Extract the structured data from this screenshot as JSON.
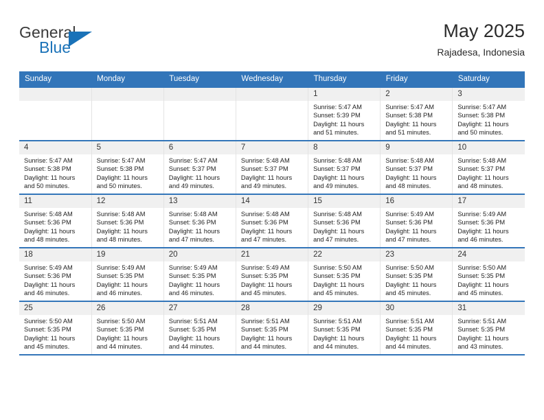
{
  "brand": {
    "name_top": "General",
    "name_bottom": "Blue",
    "triangle_color": "#1a72b8"
  },
  "header": {
    "month_title": "May 2025",
    "location": "Rajadesa, Indonesia"
  },
  "theme": {
    "header_bg": "#3275b9",
    "header_text": "#ffffff",
    "daynum_bg": "#f0f0f0",
    "row_border": "#3275b9"
  },
  "weekdays": [
    "Sunday",
    "Monday",
    "Tuesday",
    "Wednesday",
    "Thursday",
    "Friday",
    "Saturday"
  ],
  "labels": {
    "sunrise_prefix": "Sunrise:",
    "sunset_prefix": "Sunset:",
    "daylight_prefix": "Daylight:"
  },
  "weeks": [
    [
      {
        "day": "",
        "sunrise": "",
        "sunset": "",
        "daylight": ""
      },
      {
        "day": "",
        "sunrise": "",
        "sunset": "",
        "daylight": ""
      },
      {
        "day": "",
        "sunrise": "",
        "sunset": "",
        "daylight": ""
      },
      {
        "day": "",
        "sunrise": "",
        "sunset": "",
        "daylight": ""
      },
      {
        "day": "1",
        "sunrise": "Sunrise: 5:47 AM",
        "sunset": "Sunset: 5:39 PM",
        "daylight": "Daylight: 11 hours and 51 minutes."
      },
      {
        "day": "2",
        "sunrise": "Sunrise: 5:47 AM",
        "sunset": "Sunset: 5:38 PM",
        "daylight": "Daylight: 11 hours and 51 minutes."
      },
      {
        "day": "3",
        "sunrise": "Sunrise: 5:47 AM",
        "sunset": "Sunset: 5:38 PM",
        "daylight": "Daylight: 11 hours and 50 minutes."
      }
    ],
    [
      {
        "day": "4",
        "sunrise": "Sunrise: 5:47 AM",
        "sunset": "Sunset: 5:38 PM",
        "daylight": "Daylight: 11 hours and 50 minutes."
      },
      {
        "day": "5",
        "sunrise": "Sunrise: 5:47 AM",
        "sunset": "Sunset: 5:38 PM",
        "daylight": "Daylight: 11 hours and 50 minutes."
      },
      {
        "day": "6",
        "sunrise": "Sunrise: 5:47 AM",
        "sunset": "Sunset: 5:37 PM",
        "daylight": "Daylight: 11 hours and 49 minutes."
      },
      {
        "day": "7",
        "sunrise": "Sunrise: 5:48 AM",
        "sunset": "Sunset: 5:37 PM",
        "daylight": "Daylight: 11 hours and 49 minutes."
      },
      {
        "day": "8",
        "sunrise": "Sunrise: 5:48 AM",
        "sunset": "Sunset: 5:37 PM",
        "daylight": "Daylight: 11 hours and 49 minutes."
      },
      {
        "day": "9",
        "sunrise": "Sunrise: 5:48 AM",
        "sunset": "Sunset: 5:37 PM",
        "daylight": "Daylight: 11 hours and 48 minutes."
      },
      {
        "day": "10",
        "sunrise": "Sunrise: 5:48 AM",
        "sunset": "Sunset: 5:37 PM",
        "daylight": "Daylight: 11 hours and 48 minutes."
      }
    ],
    [
      {
        "day": "11",
        "sunrise": "Sunrise: 5:48 AM",
        "sunset": "Sunset: 5:36 PM",
        "daylight": "Daylight: 11 hours and 48 minutes."
      },
      {
        "day": "12",
        "sunrise": "Sunrise: 5:48 AM",
        "sunset": "Sunset: 5:36 PM",
        "daylight": "Daylight: 11 hours and 48 minutes."
      },
      {
        "day": "13",
        "sunrise": "Sunrise: 5:48 AM",
        "sunset": "Sunset: 5:36 PM",
        "daylight": "Daylight: 11 hours and 47 minutes."
      },
      {
        "day": "14",
        "sunrise": "Sunrise: 5:48 AM",
        "sunset": "Sunset: 5:36 PM",
        "daylight": "Daylight: 11 hours and 47 minutes."
      },
      {
        "day": "15",
        "sunrise": "Sunrise: 5:48 AM",
        "sunset": "Sunset: 5:36 PM",
        "daylight": "Daylight: 11 hours and 47 minutes."
      },
      {
        "day": "16",
        "sunrise": "Sunrise: 5:49 AM",
        "sunset": "Sunset: 5:36 PM",
        "daylight": "Daylight: 11 hours and 47 minutes."
      },
      {
        "day": "17",
        "sunrise": "Sunrise: 5:49 AM",
        "sunset": "Sunset: 5:36 PM",
        "daylight": "Daylight: 11 hours and 46 minutes."
      }
    ],
    [
      {
        "day": "18",
        "sunrise": "Sunrise: 5:49 AM",
        "sunset": "Sunset: 5:36 PM",
        "daylight": "Daylight: 11 hours and 46 minutes."
      },
      {
        "day": "19",
        "sunrise": "Sunrise: 5:49 AM",
        "sunset": "Sunset: 5:35 PM",
        "daylight": "Daylight: 11 hours and 46 minutes."
      },
      {
        "day": "20",
        "sunrise": "Sunrise: 5:49 AM",
        "sunset": "Sunset: 5:35 PM",
        "daylight": "Daylight: 11 hours and 46 minutes."
      },
      {
        "day": "21",
        "sunrise": "Sunrise: 5:49 AM",
        "sunset": "Sunset: 5:35 PM",
        "daylight": "Daylight: 11 hours and 45 minutes."
      },
      {
        "day": "22",
        "sunrise": "Sunrise: 5:50 AM",
        "sunset": "Sunset: 5:35 PM",
        "daylight": "Daylight: 11 hours and 45 minutes."
      },
      {
        "day": "23",
        "sunrise": "Sunrise: 5:50 AM",
        "sunset": "Sunset: 5:35 PM",
        "daylight": "Daylight: 11 hours and 45 minutes."
      },
      {
        "day": "24",
        "sunrise": "Sunrise: 5:50 AM",
        "sunset": "Sunset: 5:35 PM",
        "daylight": "Daylight: 11 hours and 45 minutes."
      }
    ],
    [
      {
        "day": "25",
        "sunrise": "Sunrise: 5:50 AM",
        "sunset": "Sunset: 5:35 PM",
        "daylight": "Daylight: 11 hours and 45 minutes."
      },
      {
        "day": "26",
        "sunrise": "Sunrise: 5:50 AM",
        "sunset": "Sunset: 5:35 PM",
        "daylight": "Daylight: 11 hours and 44 minutes."
      },
      {
        "day": "27",
        "sunrise": "Sunrise: 5:51 AM",
        "sunset": "Sunset: 5:35 PM",
        "daylight": "Daylight: 11 hours and 44 minutes."
      },
      {
        "day": "28",
        "sunrise": "Sunrise: 5:51 AM",
        "sunset": "Sunset: 5:35 PM",
        "daylight": "Daylight: 11 hours and 44 minutes."
      },
      {
        "day": "29",
        "sunrise": "Sunrise: 5:51 AM",
        "sunset": "Sunset: 5:35 PM",
        "daylight": "Daylight: 11 hours and 44 minutes."
      },
      {
        "day": "30",
        "sunrise": "Sunrise: 5:51 AM",
        "sunset": "Sunset: 5:35 PM",
        "daylight": "Daylight: 11 hours and 44 minutes."
      },
      {
        "day": "31",
        "sunrise": "Sunrise: 5:51 AM",
        "sunset": "Sunset: 5:35 PM",
        "daylight": "Daylight: 11 hours and 43 minutes."
      }
    ]
  ]
}
